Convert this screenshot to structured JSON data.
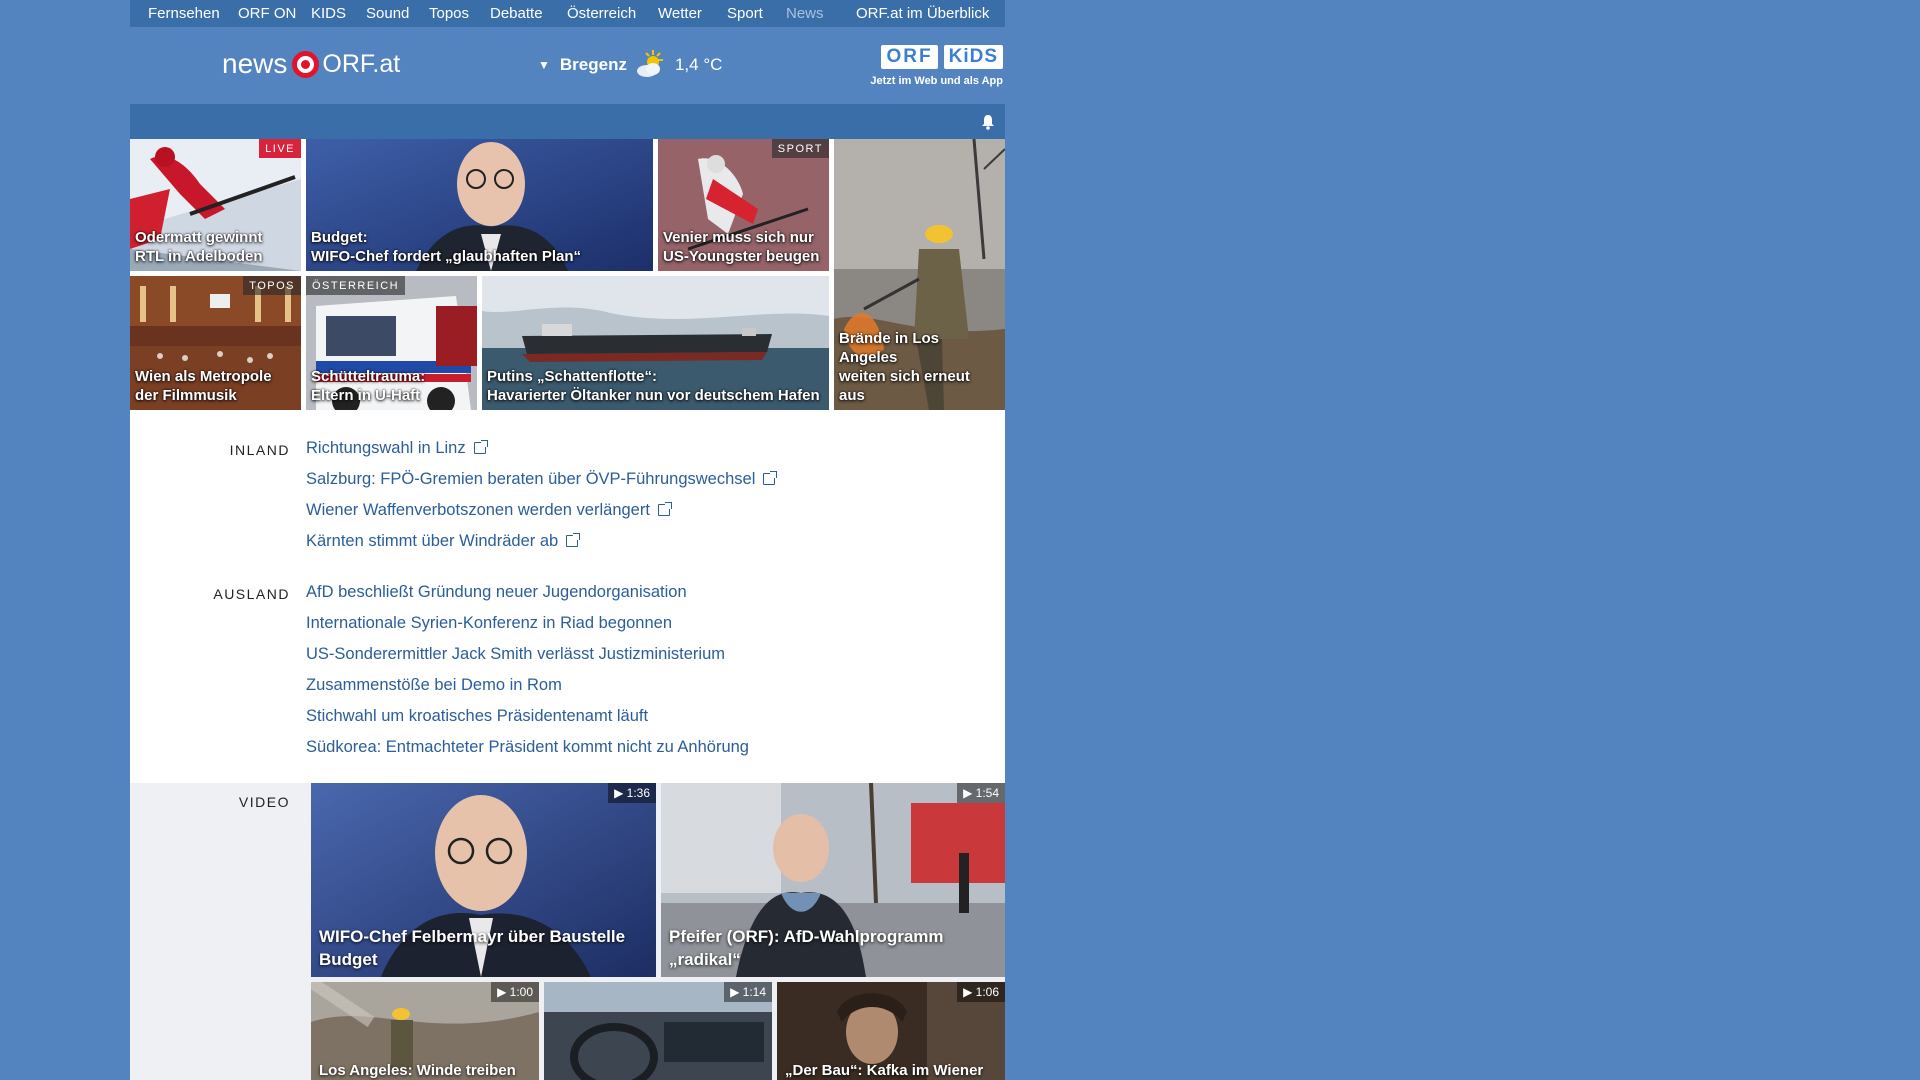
{
  "topnav": {
    "items": [
      "Fernsehen",
      "ORF ON",
      "KIDS",
      "Sound",
      "Topos",
      "Debatte",
      "Österreich",
      "Wetter",
      "Sport",
      "News"
    ],
    "overview": "ORF.at im Überblick"
  },
  "header": {
    "logo_news": "news",
    "logo_orf": "ORF.at",
    "weather_city": "Bregenz",
    "weather_temp": "1,4 °C",
    "kids_orf": "ORF",
    "kids_kids": "KiDS",
    "kids_sub": "Jetzt im Web und als App"
  },
  "tiles": [
    {
      "caption_line1": "Odermatt gewinnt",
      "caption_line2": "RTL in Adelboden",
      "tag": "LIVE"
    },
    {
      "caption_line1": "Budget:",
      "caption_line2": "WIFO-Chef fordert „glaubhaften Plan“",
      "tag": ""
    },
    {
      "caption_line1": "Venier muss sich nur",
      "caption_line2": "US-Youngster beugen",
      "tag": "SPORT"
    },
    {
      "caption_line1": "Brände in Los Angeles",
      "caption_line2": "weiten sich erneut aus",
      "tag": ""
    },
    {
      "caption_line1": "Wien als Metropole",
      "caption_line2": "der Filmmusik",
      "tag": "TOPOS"
    },
    {
      "caption_line1": "Schütteltrauma:",
      "caption_line2": "Eltern in U-Haft",
      "tag": "ÖSTERREICH"
    },
    {
      "caption_line1": "Putins „Schattenflotte“:",
      "caption_line2": "Havarierter Öltanker nun vor deutschem Hafen",
      "tag": ""
    }
  ],
  "inland": {
    "label": "INLAND",
    "items": [
      "Richtungswahl in Linz",
      "Salzburg: FPÖ-Gremien beraten über ÖVP-Führungswechsel",
      "Wiener Waffenverbotszonen werden verlängert",
      "Kärnten stimmt über Windräder ab"
    ]
  },
  "ausland": {
    "label": "AUSLAND",
    "items": [
      "AfD beschließt Gründung neuer Jugendorganisation",
      "Internationale Syrien-Konferenz in Riad begonnen",
      "US-Sonderermittler Jack Smith verlässt Justizministerium",
      "Zusammenstöße bei Demo in Rom",
      "Stichwahl um kroatisches Präsidentenamt läuft",
      "Südkorea: Entmachteter Präsident kommt nicht zu Anhörung"
    ]
  },
  "video": {
    "label": "VIDEO",
    "items": [
      {
        "duration": "1:36",
        "caption_line1": "WIFO-Chef Felbermayr über Baustelle",
        "caption_line2": "Budget"
      },
      {
        "duration": "1:54",
        "caption_line1": "Pfeifer (ORF): AfD-Wahlprogramm",
        "caption_line2": "„radikal“"
      },
      {
        "duration": "1:00",
        "caption_line1": "Los Angeles: Winde treiben",
        "caption_line2": ""
      },
      {
        "duration": "1:14",
        "caption_line1": "",
        "caption_line2": ""
      },
      {
        "duration": "1:06",
        "caption_line1": "„Der Bau“: Kafka im Wiener",
        "caption_line2": ""
      }
    ]
  },
  "colors": {
    "background": "#5484c0",
    "nav_bar": "#3a6ea8",
    "link": "#2a5e9a",
    "live_red": "#d9233a",
    "logo_red": "#e0142c"
  }
}
